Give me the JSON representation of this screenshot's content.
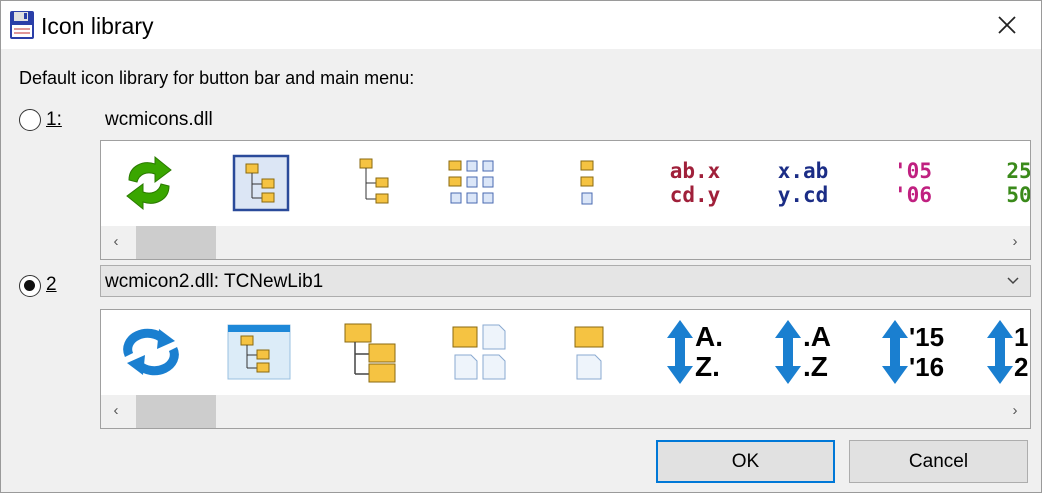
{
  "window": {
    "title": "Icon library",
    "app_icon": "floppy-disk-icon",
    "close_icon": "close-icon"
  },
  "heading": "Default icon library for button bar and main menu:",
  "option1": {
    "label": "1:",
    "library": "wcmicons.dll",
    "selected": false,
    "icons": [
      "refresh-arrows-icon",
      "folder-tree-selected-icon",
      "folder-tree-icon",
      "folder-grid-icon",
      "folder-list-icon",
      "ab-x-cd-y",
      "x-ab-y-cd",
      "05-06",
      "25-50"
    ],
    "text_icons": {
      "abx": [
        "ab.x",
        "cd.y"
      ],
      "xab": [
        "x.ab",
        "y.cd"
      ],
      "yr": [
        "'05",
        "'06"
      ],
      "num": [
        "25",
        "50"
      ]
    }
  },
  "option2": {
    "label": "2",
    "selected": true,
    "combo_value": "wcmicon2.dll: TCNewLib1",
    "icons": [
      "sync-circle-icon",
      "window-tree-icon",
      "folder-tree-icon",
      "folder-file-grid-icon",
      "folder-file-icon",
      "sort-az-icon",
      "sort-az-dot-icon",
      "sort-year-icon",
      "sort-num-icon"
    ],
    "text_icons": {
      "az1": [
        "A.",
        "Z."
      ],
      "az2": [
        ".A",
        ".Z"
      ],
      "yr": [
        "'15",
        "'16"
      ],
      "num": [
        "1",
        "2"
      ]
    }
  },
  "scroll": {
    "left": "‹",
    "right": "›"
  },
  "buttons": {
    "ok": "OK",
    "cancel": "Cancel"
  },
  "colors": {
    "accent": "#0078d7",
    "green": "#3aa600",
    "folder": "#f5c342",
    "maroon": "#a0203a",
    "navy": "#1b2d86",
    "magenta": "#c02080",
    "olive_green": "#3a8a1a",
    "arrow_blue": "#1a7fd0"
  }
}
